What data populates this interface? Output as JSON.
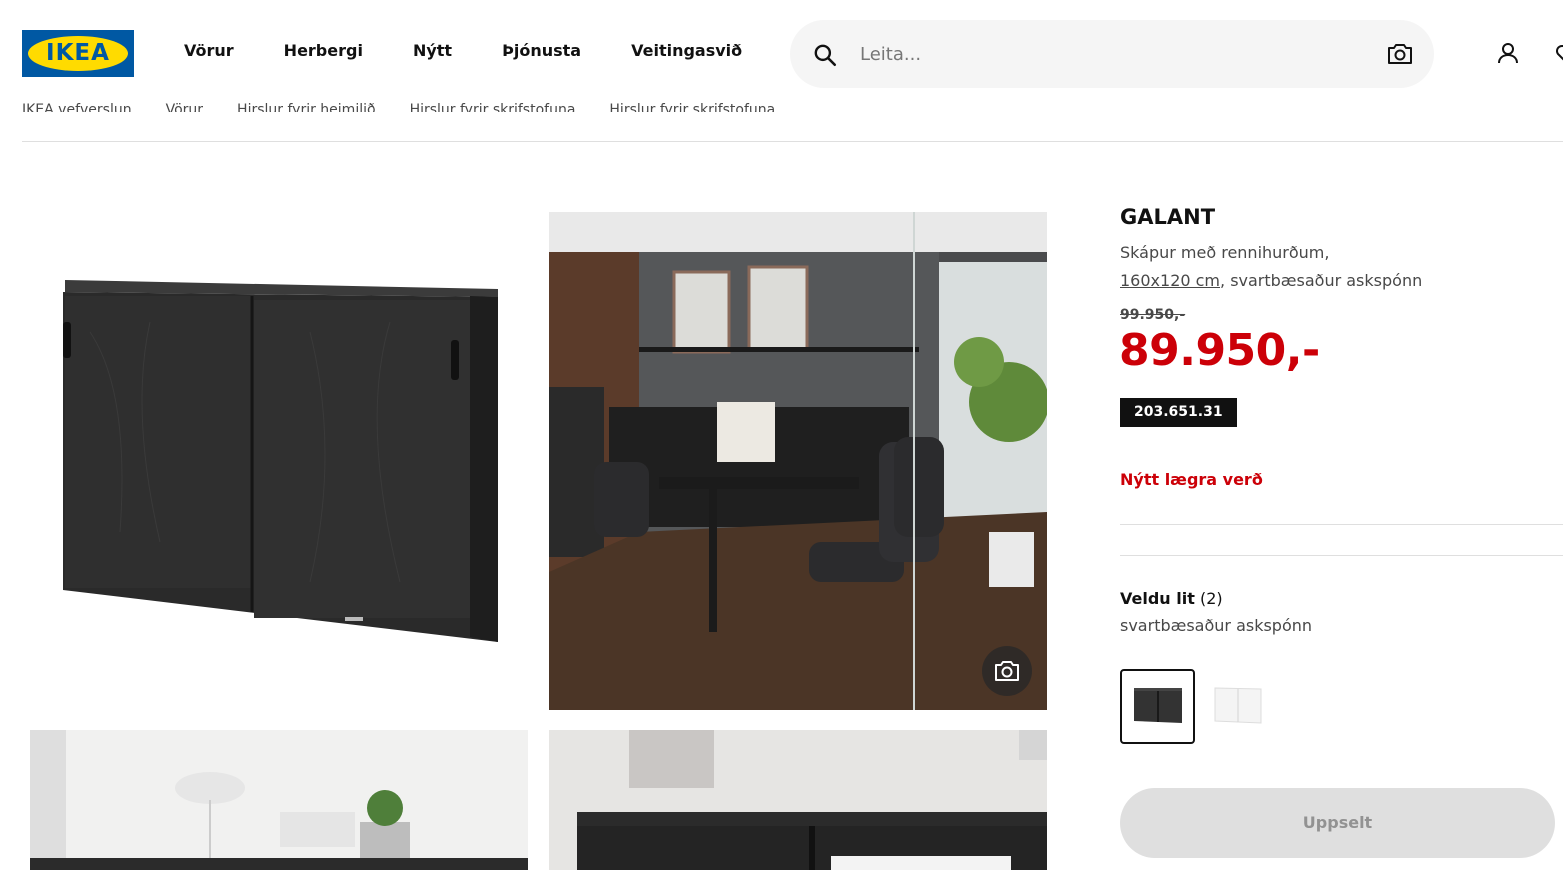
{
  "header": {
    "logo_text": "IKEA",
    "nav": [
      "Vörur",
      "Herbergi",
      "Nýtt",
      "Þjónusta",
      "Veitingasvið"
    ],
    "search": {
      "placeholder": "Leita..."
    },
    "icons": [
      "search-icon",
      "camera-icon",
      "user-icon",
      "heart-icon"
    ]
  },
  "breadcrumb": [
    "IKEA vefverslun",
    "Vörur",
    "Hirslur fyrir heimilið",
    "Hirslur fyrir skrifstofuna",
    "Hirslur fyrir skrifstofuna"
  ],
  "product": {
    "name": "GALANT",
    "description_line1": "Skápur með rennihurðum,",
    "size": "160x120 cm",
    "description_suffix": ", svartbæsaður askspónn",
    "old_price": "99.950,-",
    "price": "89.950,-",
    "article_number": "203.651.31",
    "price_label": "Nýtt lægra verð",
    "color_label": "Veldu lit",
    "color_count": "(2)",
    "color_selected": "svartbæsaður askspónn",
    "sold_out_label": "Uppselt"
  },
  "colors": {
    "brand_blue": "#0058a3",
    "brand_yellow": "#ffdb00",
    "price_red": "#cc0008"
  }
}
